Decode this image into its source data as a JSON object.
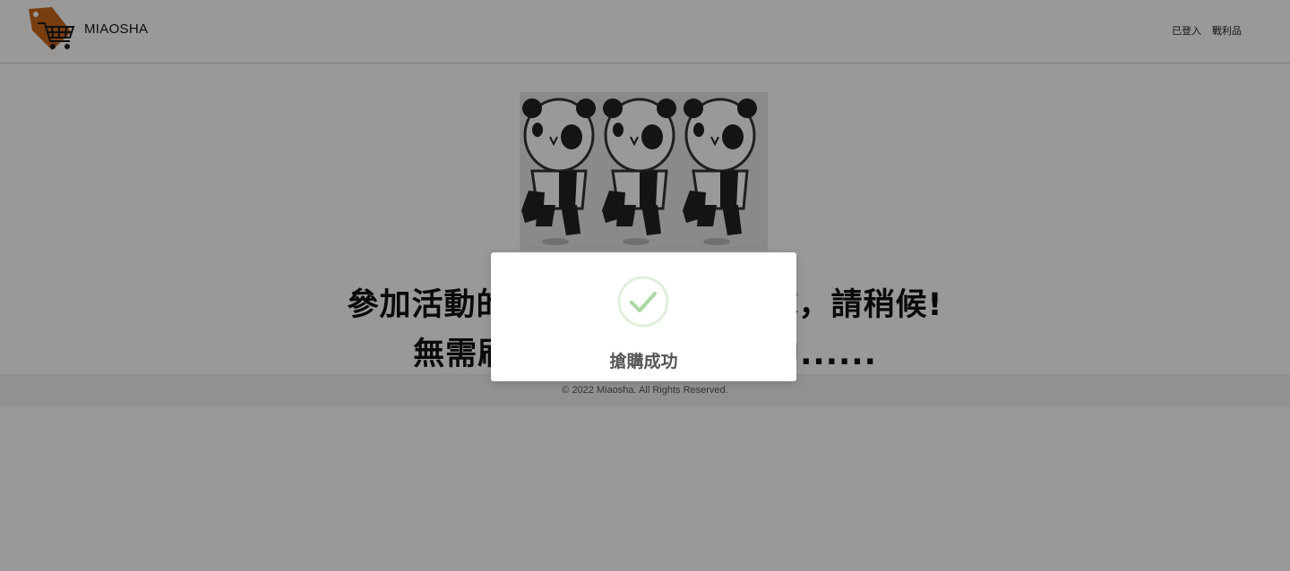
{
  "header": {
    "brand": "MIAOSHA",
    "nav": [
      "已登入",
      "戰利品"
    ],
    "logo_icon": "shopping-cart-tag-icon"
  },
  "main": {
    "image_icon": "dancing-pandas-illustration",
    "queue_line1": "參加活動的人數太多，正在排隊，請稍候!",
    "queue_line2": "無需刷新頁面，排隊進行中......"
  },
  "footer": {
    "copyright": "© 2022 Miaosha. All Rights Reserved."
  },
  "modal": {
    "status_icon": "check-circle-icon",
    "message": "搶購成功"
  },
  "colors": {
    "overlay": "#000000",
    "logo_orange": "#c8671a",
    "success_green": "#a8d8a0"
  }
}
